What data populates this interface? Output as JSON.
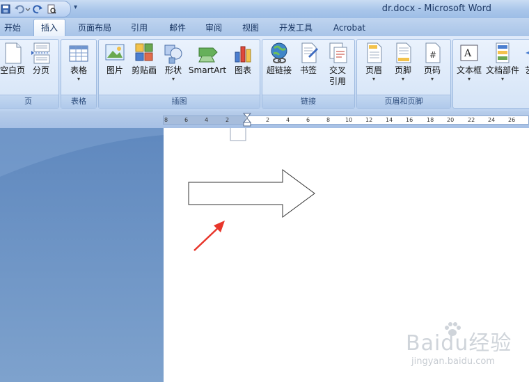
{
  "window": {
    "title": "dr.docx - Microsoft Word"
  },
  "tabs": [
    "开始",
    "插入",
    "页面布局",
    "引用",
    "邮件",
    "审阅",
    "视图",
    "开发工具",
    "Acrobat"
  ],
  "active_tab": "插入",
  "ribbon": {
    "groups": [
      {
        "label": "页",
        "buttons": [
          "空白页",
          "分页"
        ]
      },
      {
        "label": "表格",
        "buttons": [
          "表格"
        ]
      },
      {
        "label": "插图",
        "buttons": [
          "图片",
          "剪贴画",
          "形状",
          "SmartArt",
          "图表"
        ]
      },
      {
        "label": "链接",
        "buttons": [
          "超链接",
          "书签",
          "交叉\n引用"
        ]
      },
      {
        "label": "页眉和页脚",
        "buttons": [
          "页眉",
          "页脚",
          "页码"
        ]
      },
      {
        "label": "",
        "buttons": [
          "文本框",
          "文档部件",
          "艺"
        ]
      }
    ]
  },
  "ruler": {
    "ticks": [
      "8",
      "6",
      "4",
      "2",
      "2",
      "4",
      "6",
      "8",
      "10",
      "12",
      "14",
      "16",
      "18",
      "20",
      "22",
      "24",
      "26"
    ]
  },
  "watermark": {
    "brand": "Baidu经验",
    "url": "jingyan.baidu.com"
  },
  "colors": {
    "annotation_arrow": "#e8362b",
    "ribbon_bg": "#d5e4f7",
    "title_text": "#1f3a66"
  }
}
